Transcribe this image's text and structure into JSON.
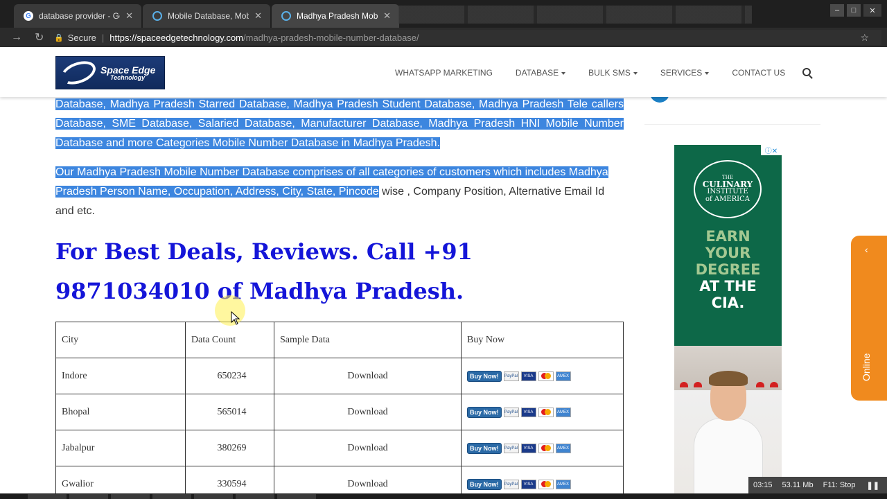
{
  "browser": {
    "tabs": [
      {
        "title": "database provider - Goo",
        "icon": "google-icon"
      },
      {
        "title": "Mobile Database, Mobile",
        "icon": "site-icon"
      },
      {
        "title": "Madhya Pradesh Mobile",
        "icon": "site-icon"
      }
    ],
    "close_symbol": "✕",
    "secure_label": "Secure",
    "url_main": "https://spaceedgetechnology.com",
    "url_rest": "/madhya-pradesh-mobile-number-database/"
  },
  "header": {
    "logo_line1": "Space Edge",
    "logo_line2": "Technology",
    "menu": [
      "WHATSAPP MARKETING",
      "DATABASE",
      "BULK SMS",
      "SERVICES",
      "CONTACT US"
    ]
  },
  "content": {
    "para1": "Database, Madhya Pradesh Starred Database, Madhya Pradesh Student Database, Madhya Pradesh Tele callers Database, SME Database, Salaried Database, Manufacturer Database, Madhya Pradesh HNI Mobile Number Database and more Categories Mobile Number Database in Madhya Pradesh.",
    "para2_highlighted": "Our Madhya Pradesh Mobile Number Database comprises of all categories of customers which includes Madhya Pradesh Person Name, Occupation, Address, City, State, Pincode",
    "para2_rest": " wise , Company Position, Alternative Email Id and etc.",
    "callout": "For Best Deals, Reviews. Call +91 9871034010 of Madhya Pradesh."
  },
  "table": {
    "headers": [
      "City",
      "Data Count",
      "Sample Data",
      "Buy Now"
    ],
    "rows": [
      {
        "city": "Indore",
        "count": "650234",
        "sample": "Download"
      },
      {
        "city": "Bhopal",
        "count": "565014",
        "sample": "Download"
      },
      {
        "city": "Jabalpur",
        "count": "380269",
        "sample": "Download"
      },
      {
        "city": "Gwalior",
        "count": "330594",
        "sample": "Download"
      }
    ],
    "buy_label": "Buy Now!",
    "card_labels": {
      "paypal": "PayPal",
      "visa": "VISA",
      "amex": "AMEX"
    }
  },
  "ad": {
    "adchoices": "ⓘ✕",
    "logo_top": "THE",
    "logo_mid": "CULINARY",
    "logo_inst": "INSTITUTE",
    "logo_bottom": "of AMERICA",
    "line1": "EARN",
    "line2": "YOUR",
    "line3": "DEGREE",
    "line4": "AT THE",
    "line5": "CIA."
  },
  "online_widget": {
    "label": "Online"
  },
  "recorder": {
    "time": "03:15",
    "size": "53.11 Mb",
    "stop": "F11: Stop",
    "pause": "❚❚"
  }
}
